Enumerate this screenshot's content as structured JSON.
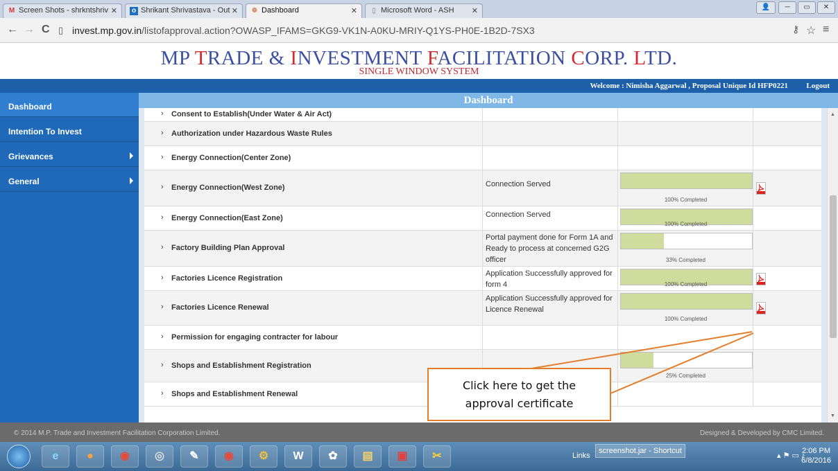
{
  "browser": {
    "tabs": [
      {
        "label": "Screen Shots - shrkntshriv",
        "icon": "gmail-icon"
      },
      {
        "label": "Shrikant Shrivastava - Out",
        "icon": "outlook-icon"
      },
      {
        "label": "Dashboard",
        "icon": "site-icon"
      },
      {
        "label": "Microsoft Word - ASH",
        "icon": "page-icon"
      }
    ],
    "url_host": "invest.mp.gov.in",
    "url_path": "/listofapproval.action?OWASP_IFAMS=GKG9-VK1N-A0KU-MRIY-Q1YS-PH0E-1B2D-7SX3"
  },
  "header": {
    "title_parts": [
      "MP ",
      "T",
      "RADE & ",
      "I",
      "NVESTMENT ",
      "F",
      "ACILITATION ",
      "C",
      "ORP. ",
      "L",
      "TD."
    ],
    "subtitle": "SINGLE WINDOW SYSTEM",
    "welcome": "Welcome :  Nimisha Aggarwal , Proposal Unique Id HFP0221",
    "logout": "Logout"
  },
  "sidebar": {
    "items": [
      {
        "label": "Dashboard",
        "has_submenu": false
      },
      {
        "label": "Intention To Invest",
        "has_submenu": false
      },
      {
        "label": "Grievances",
        "has_submenu": true
      },
      {
        "label": "General",
        "has_submenu": true
      }
    ]
  },
  "main": {
    "title": "Dashboard",
    "rows": [
      {
        "name": "Consent to Establish(Under Water & Air Act)",
        "status": "",
        "progress": null,
        "progress_label": "",
        "pdf": false
      },
      {
        "name": "Authorization under Hazardous Waste Rules",
        "status": "",
        "progress": null,
        "progress_label": "",
        "pdf": false
      },
      {
        "name": "Energy Connection(Center Zone)",
        "status": "",
        "progress": null,
        "progress_label": "",
        "pdf": false
      },
      {
        "name": "Energy Connection(West Zone)",
        "status": "Connection Served",
        "progress": 1.0,
        "progress_label": "100% Completed",
        "pdf": true
      },
      {
        "name": "Energy Connection(East Zone)",
        "status": "Connection Served",
        "progress": 1.0,
        "progress_label": "100% Completed",
        "pdf": false
      },
      {
        "name": "Factory Building Plan Approval",
        "status": "Portal payment done for Form 1A and Ready to process at concerned G2G officer",
        "progress": 0.33,
        "progress_label": "33% Completed",
        "pdf": false
      },
      {
        "name": "Factories Licence Registration",
        "status": "Application Successfully approved for form 4",
        "progress": 1.0,
        "progress_label": "100% Completed",
        "pdf": true
      },
      {
        "name": "Factories Licence Renewal",
        "status": "Application Successfully approved for Licence Renewal",
        "progress": 1.0,
        "progress_label": "100% Completed",
        "pdf": true
      },
      {
        "name": "Permission for engaging contracter for labour",
        "status": "",
        "progress": null,
        "progress_label": "",
        "pdf": false
      },
      {
        "name": "Shops and Establishment Registration",
        "status": "",
        "progress": 0.25,
        "progress_label": "25% Completed",
        "pdf": false
      },
      {
        "name": "Shops and Establishment Renewal",
        "status": "",
        "progress": null,
        "progress_label": "",
        "pdf": false
      }
    ]
  },
  "callout": {
    "line1": "Click here to get the",
    "line2": "approval certificate"
  },
  "footer": {
    "left": "© 2014 M.P. Trade and Investment Facilitation Corporation Limited.",
    "right": "Designed & Developed by CMC Limited."
  },
  "taskbar": {
    "links": "Links",
    "shortcut": "screenshot.jar - Shortcut",
    "time": "2:06 PM",
    "date": "6/8/2016"
  },
  "colors": {
    "brand_blue": "#3b4fa3",
    "brand_red": "#d5282e",
    "sidebar": "#1f69b8",
    "progress_fill": "#cfdc9d",
    "callout_border": "#e37d28"
  }
}
